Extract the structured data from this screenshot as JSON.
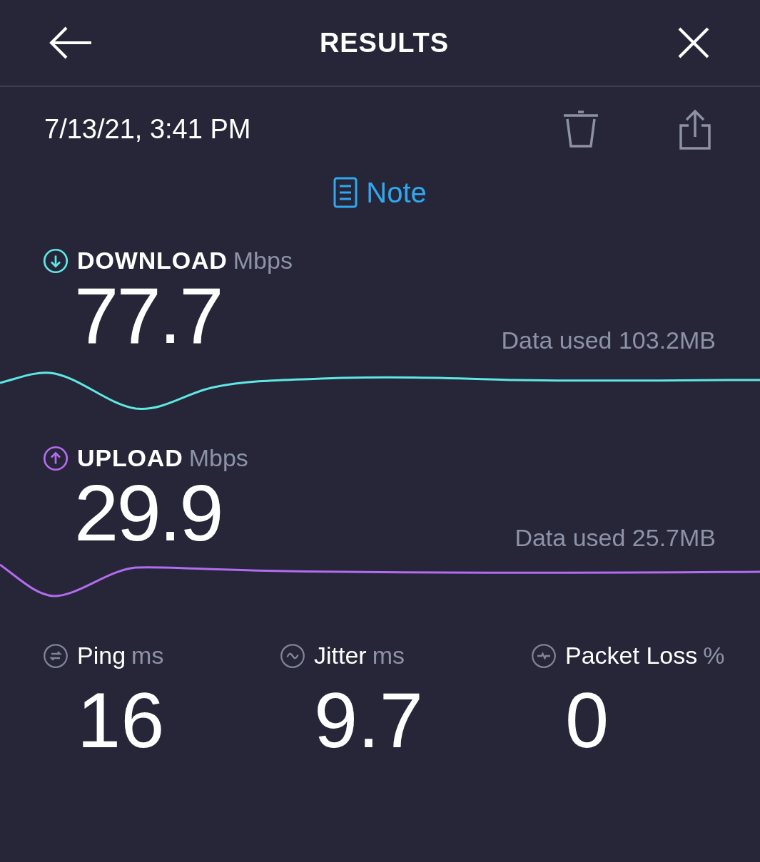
{
  "header": {
    "title": "RESULTS"
  },
  "result": {
    "timestamp": "7/13/21, 3:41 PM",
    "note_link": "Note"
  },
  "tests": [
    {
      "label": "DOWNLOAD",
      "unit": "Mbps",
      "value": "77.7",
      "data_used": "Data used 103.2MB",
      "color": "#5ee8e6",
      "kind": "down"
    },
    {
      "label": "UPLOAD",
      "unit": "Mbps",
      "value": "29.9",
      "data_used": "Data used 25.7MB",
      "color": "#b26cf0",
      "kind": "up"
    }
  ],
  "metrics": [
    {
      "kind": "ping",
      "label": "Ping",
      "unit": "ms",
      "value": "16"
    },
    {
      "kind": "jitter",
      "label": "Jitter",
      "unit": "ms",
      "value": "9.7"
    },
    {
      "kind": "packet_loss",
      "label": "Packet Loss",
      "unit": "%",
      "value": "0"
    }
  ]
}
